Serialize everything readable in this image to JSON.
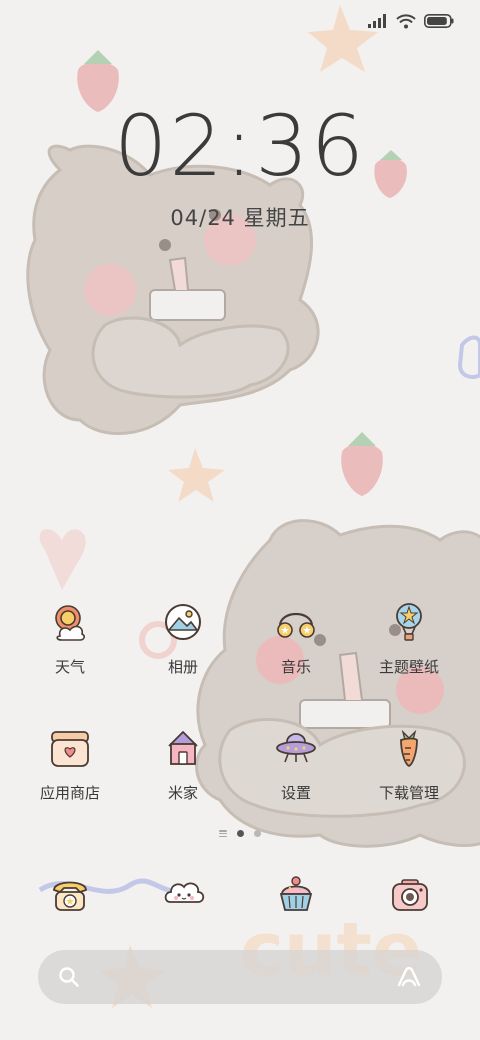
{
  "status_bar": {
    "signal_icon": "signal-bars-icon",
    "wifi_icon": "wifi-icon",
    "battery_icon": "battery-icon",
    "battery_level": 0.9
  },
  "lock": {
    "time": "02:36",
    "date": "04/24 星期五"
  },
  "apps": [
    {
      "label": "天气",
      "icon": "weather-icon"
    },
    {
      "label": "相册",
      "icon": "gallery-icon"
    },
    {
      "label": "音乐",
      "icon": "music-icon"
    },
    {
      "label": "主题壁纸",
      "icon": "themes-icon"
    },
    {
      "label": "应用商店",
      "icon": "app-store-icon"
    },
    {
      "label": "米家",
      "icon": "mi-home-icon"
    },
    {
      "label": "设置",
      "icon": "settings-icon"
    },
    {
      "label": "下载管理",
      "icon": "downloads-icon"
    }
  ],
  "pager": {
    "pages": 2,
    "active_page": 1
  },
  "dock": [
    {
      "icon": "phone-icon"
    },
    {
      "icon": "messages-icon"
    },
    {
      "icon": "browser-icon"
    },
    {
      "icon": "camera-icon"
    }
  ],
  "search": {
    "placeholder": "",
    "search_icon": "search-icon",
    "assistant_icon": "assistant-icon"
  },
  "wallpaper": {
    "text": "cute",
    "colors": {
      "bear": "#cfc6be",
      "strawberry": "#e8a7a7",
      "star": "#f3d6bd",
      "background": "#f2f1f0"
    }
  }
}
